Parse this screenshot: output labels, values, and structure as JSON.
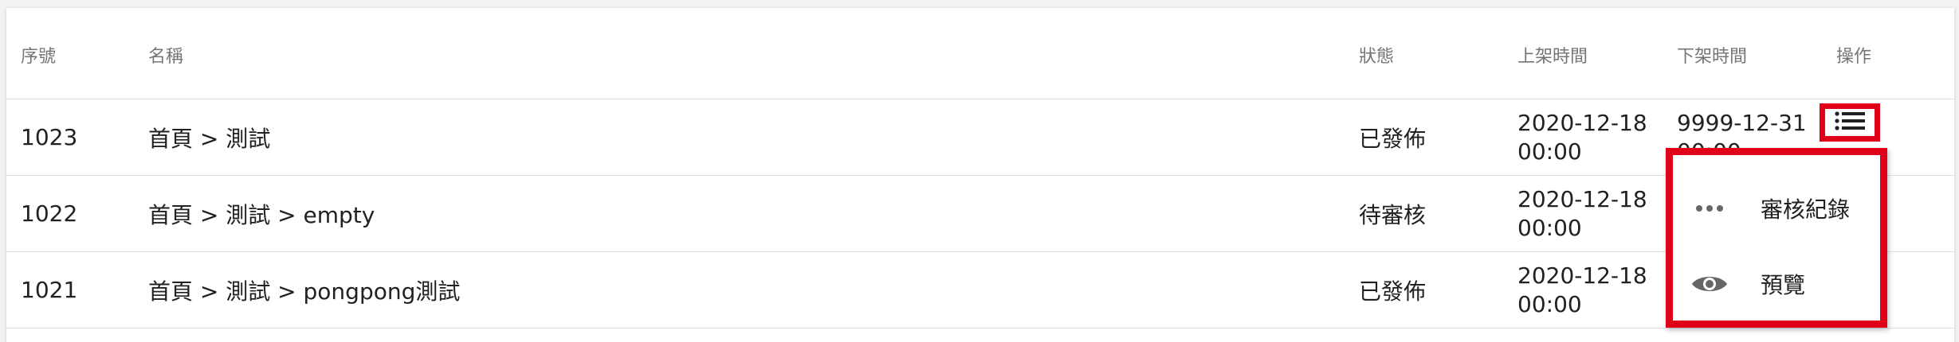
{
  "table": {
    "headers": {
      "id": "序號",
      "name": "名稱",
      "status": "狀態",
      "start": "上架時間",
      "end": "下架時間",
      "ops": "操作"
    },
    "rows": [
      {
        "id": "1023",
        "name": "首頁 > 測試",
        "status": "已發佈",
        "start_date": "2020-12-18",
        "start_time": "00:00",
        "end_date": "9999-12-31",
        "end_time": "00:00"
      },
      {
        "id": "1022",
        "name": "首頁 > 測試 > empty",
        "status": "待審核",
        "start_date": "2020-12-18",
        "start_time": "00:00",
        "end_date": "",
        "end_time": ""
      },
      {
        "id": "1021",
        "name": "首頁 > 測試 > pongpong測試",
        "status": "已發佈",
        "start_date": "2020-12-18",
        "start_time": "00:00",
        "end_date": "",
        "end_time": ""
      }
    ]
  },
  "menu": {
    "trigger_icon": "list-icon",
    "items": [
      {
        "label": "審核紀錄",
        "icon": "more-horiz-icon"
      },
      {
        "label": "預覽",
        "icon": "eye-icon"
      }
    ]
  },
  "colors": {
    "highlight": "#e0001a",
    "header_text": "#757575",
    "body_text": "#212121",
    "icon": "#666666"
  }
}
